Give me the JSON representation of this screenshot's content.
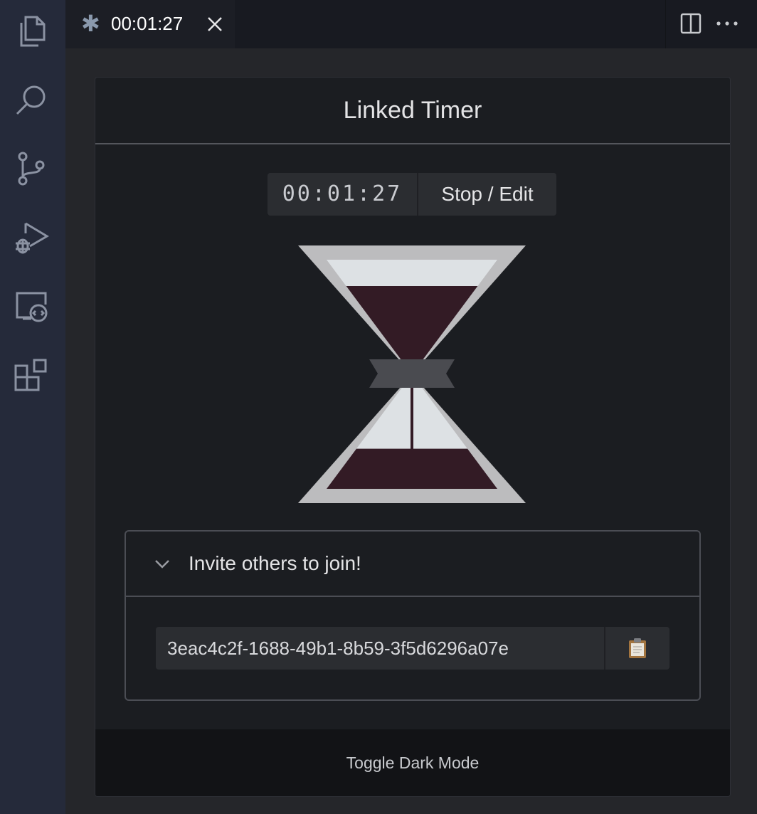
{
  "activity_bar": {
    "icons": [
      "files-icon",
      "search-icon",
      "source-control-icon",
      "run-debug-icon",
      "remote-explorer-icon",
      "extensions-icon"
    ]
  },
  "tab": {
    "title": "00:01:27",
    "modified_indicator": "✱"
  },
  "panel": {
    "title": "Linked Timer",
    "timer_display": "00:01:27",
    "stop_button": "Stop / Edit",
    "invite_title": "Invite others to join!",
    "invite_code": "3eac4c2f-1688-49b1-8b59-3f5d6296a07e",
    "footer_button": "Toggle Dark Mode"
  },
  "hourglass": {
    "top_sand_remaining": 0.77,
    "bottom_sand_filled": 0.35
  },
  "colors": {
    "activity_bar_bg": "#252a3a",
    "card_bg": "#1b1d21",
    "sand": "#331b25",
    "glass": "#dde1e4",
    "frame": "#bcbcbe"
  }
}
